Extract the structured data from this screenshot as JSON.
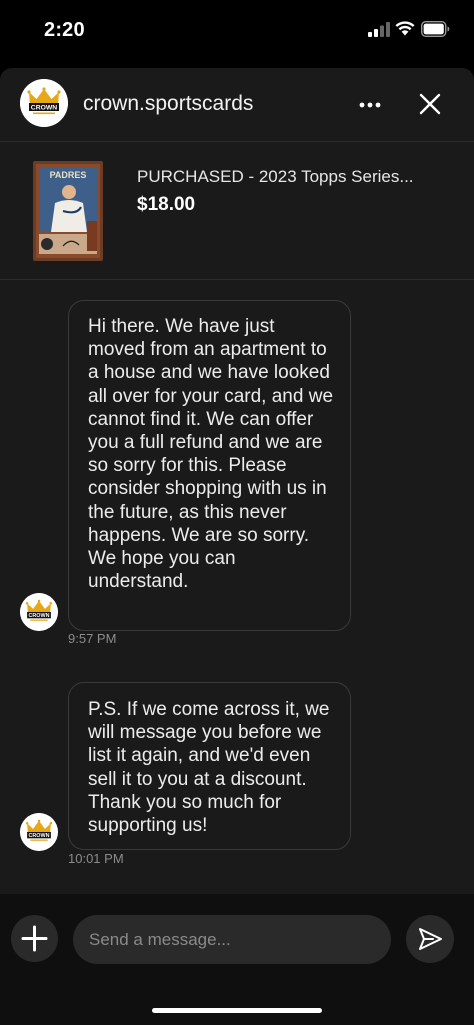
{
  "status_bar": {
    "time": "2:20"
  },
  "header": {
    "username": "crown.sportscards",
    "logo_text": "CROWN"
  },
  "product": {
    "title": "PURCHASED - 2023 Topps Series...",
    "price": "$18.00",
    "card_team": "PADRES"
  },
  "messages": [
    {
      "text": "Hi there. We have just moved from an apartment to a house and we have looked all over for your card, and we cannot find it. We can offer you a full refund and we are so sorry for this. Please consider shopping with us in the future, as this never happens. We are so sorry. We hope you can understand.",
      "time": "9:57 PM"
    },
    {
      "text": "P.S. If we come across it, we will message you before we list it again, and we'd even sell it to you at a discount. Thank you so much for supporting us!",
      "time": "10:01 PM"
    }
  ],
  "composer": {
    "placeholder": "Send a message..."
  },
  "colors": {
    "background": "#1a1a1a",
    "bubble_border": "#3a3a3a",
    "crown_gold": "#e6a817"
  }
}
